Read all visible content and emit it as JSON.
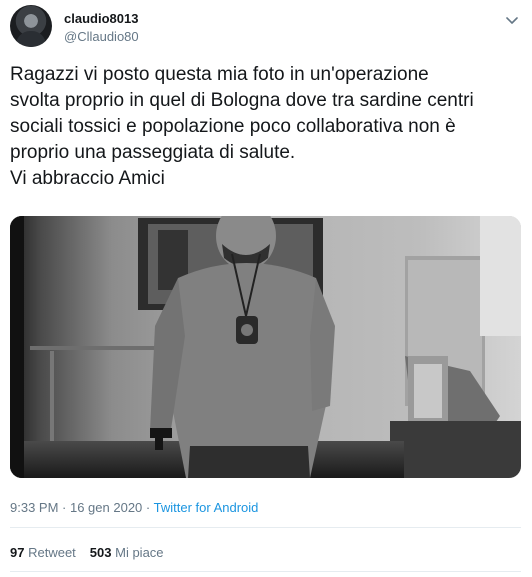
{
  "user": {
    "name": "claudio8013",
    "handle": "@Cllaudio80"
  },
  "icons": {
    "menu": "chevron-down-icon"
  },
  "tweet": {
    "text": "Ragazzi vi posto questa mia foto in un'operazione\nsvolta proprio in quel di Bologna dove tra sardine centri\nsociali tossici e popolazione poco collaborativa non è\nproprio una passeggiata di salute.\nVi abbraccio Amici"
  },
  "meta": {
    "time": "9:33 PM",
    "separator": " · ",
    "date": "16 gen 2020",
    "source": "Twitter for Android"
  },
  "stats": {
    "retweets_count": "97",
    "retweets_label": "Retweet",
    "likes_count": "503",
    "likes_label": "Mi piace"
  },
  "colors": {
    "text": "#14171a",
    "secondary": "#657786",
    "link": "#1b95e0",
    "divider": "#e6ecf0"
  }
}
